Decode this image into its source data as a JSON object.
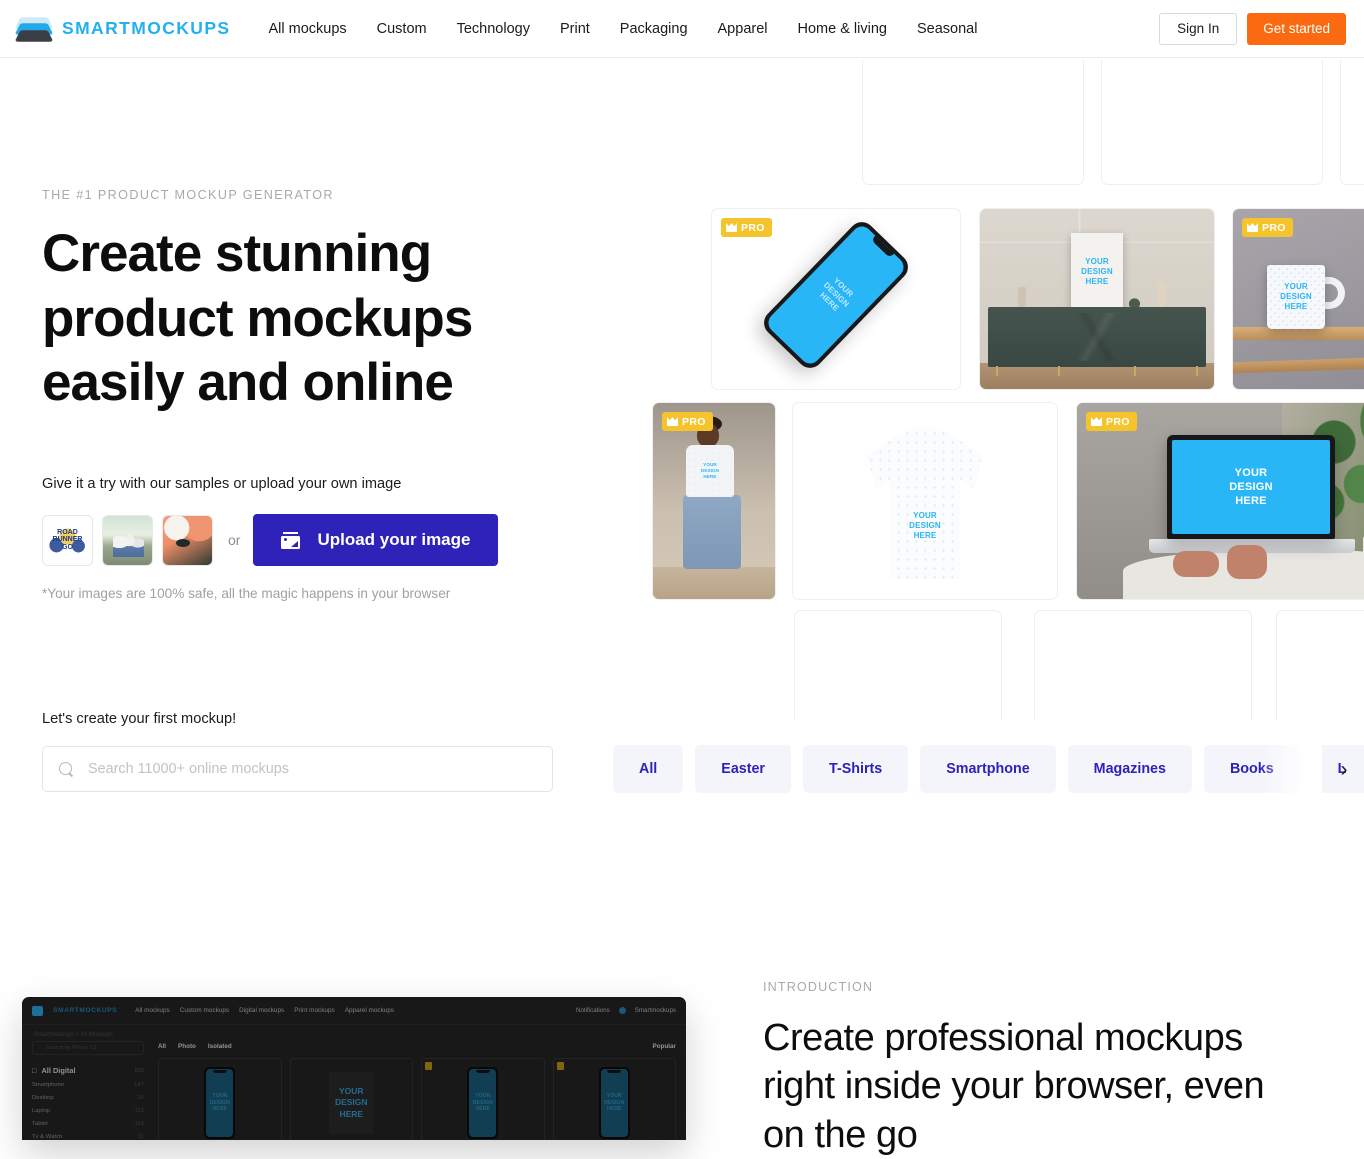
{
  "header": {
    "brand": "SMARTMOCKUPS",
    "logo_icon": "layers-stack-icon",
    "nav": [
      {
        "label": "All mockups"
      },
      {
        "label": "Custom"
      },
      {
        "label": "Technology"
      },
      {
        "label": "Print"
      },
      {
        "label": "Packaging"
      },
      {
        "label": "Apparel"
      },
      {
        "label": "Home & living"
      },
      {
        "label": "Seasonal"
      }
    ],
    "sign_in": "Sign In",
    "get_started": "Get started",
    "get_started_color": "#fb6a10"
  },
  "hero": {
    "eyebrow": "THE #1 PRODUCT MOCKUP GENERATOR",
    "title": "Create stunning product mockups easily and online",
    "try_label": "Give it a try with our samples or upload your own image",
    "or": "or",
    "upload_label": "Upload your image",
    "upload_icon": "image-icon",
    "upload_color": "#2e22b8",
    "safe_note": "*Your images are 100% safe, all the magic happens in your browser",
    "samples": [
      {
        "name": "sample-road-runner-go",
        "caption": "ROAD\nRUNNER\nGO"
      },
      {
        "name": "sample-family-park",
        "caption": ""
      },
      {
        "name": "sample-abstract-orange",
        "caption": ""
      }
    ]
  },
  "search": {
    "label": "Let's create your first mockup!",
    "placeholder": "Search 11000+ online mockups",
    "value": "",
    "icon": "search-icon"
  },
  "chips": {
    "items": [
      {
        "label": "All"
      },
      {
        "label": "Easter"
      },
      {
        "label": "T-Shirts"
      },
      {
        "label": "Smartphone"
      },
      {
        "label": "Magazines"
      },
      {
        "label": "Books"
      },
      {
        "label": "L"
      }
    ],
    "next_icon": "chevron-right-icon",
    "text_color": "#2e22b8",
    "bg_color": "#f4f5fb"
  },
  "mockups": {
    "pro_label": "PRO",
    "pro_icon": "crown-icon",
    "pro_color": "#f5c32c",
    "design_placeholder": "YOUR\nDESIGN\nHERE",
    "design_color": "#29b6f6",
    "cards": [
      {
        "name": "mockup-smartphone",
        "pro": true
      },
      {
        "name": "mockup-poster-sideboard",
        "pro": false
      },
      {
        "name": "mockup-mug-shelf",
        "pro": true
      },
      {
        "name": "mockup-tshirt-person",
        "pro": true
      },
      {
        "name": "mockup-tshirt-flat",
        "pro": false
      },
      {
        "name": "mockup-laptop-desk",
        "pro": true
      }
    ]
  },
  "app_shot": {
    "brand": "SMARTMOCKUPS",
    "nav": [
      "All mockups",
      "Custom mockups",
      "Digital mockups",
      "Print mockups",
      "Apparel mockups"
    ],
    "notifications": "Notifications",
    "account": "Smartmockups",
    "breadcrumb": "Smartmockups  >  All Mockups",
    "search_placeholder": "Search by Phone 13",
    "category": "All Digital",
    "category_count": "501",
    "sidebar": [
      {
        "label": "Smartphone",
        "count": "147"
      },
      {
        "label": "Desktop",
        "count": "36"
      },
      {
        "label": "Laptop",
        "count": "112"
      },
      {
        "label": "Tablet",
        "count": "118"
      },
      {
        "label": "Tv & Watch",
        "count": "31"
      }
    ],
    "tabs": [
      "All",
      "Photo",
      "Isolated"
    ],
    "sort": "Popular",
    "design_placeholder": "YOUR\nDESIGN\nHERE"
  },
  "intro": {
    "eyebrow": "INTRODUCTION",
    "title": "Create professional mockups right inside your browser, even on the go"
  }
}
